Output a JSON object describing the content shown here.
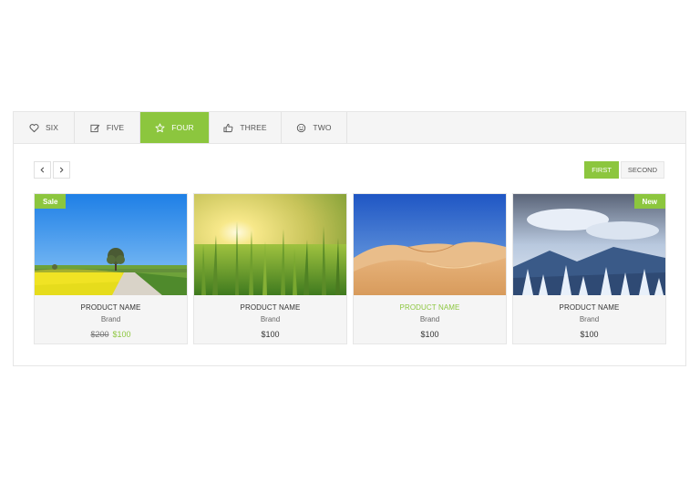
{
  "tabs": [
    {
      "label": "SIX",
      "icon": "heart-icon",
      "active": false
    },
    {
      "label": "FIVE",
      "icon": "edit-icon",
      "active": false
    },
    {
      "label": "FOUR",
      "icon": "star-icon",
      "active": true
    },
    {
      "label": "THREE",
      "icon": "thumbs-up-icon",
      "active": false
    },
    {
      "label": "TWO",
      "icon": "smile-icon",
      "active": false
    }
  ],
  "subtabs": [
    {
      "label": "FIRST",
      "active": true
    },
    {
      "label": "SECOND",
      "active": false
    }
  ],
  "products": [
    {
      "name": "PRODUCT NAME",
      "brand": "Brand",
      "old_price": "$200",
      "price": "$100",
      "badge": "Sale",
      "image": "road-field-photo",
      "highlight": false
    },
    {
      "name": "PRODUCT NAME",
      "brand": "Brand",
      "price": "$100",
      "image": "wheat-field-photo",
      "highlight": false
    },
    {
      "name": "PRODUCT NAME",
      "brand": "Brand",
      "price": "$100",
      "image": "desert-dunes-photo",
      "highlight": true
    },
    {
      "name": "PRODUCT NAME",
      "brand": "Brand",
      "price": "$100",
      "badge": "New",
      "image": "snowy-mountain-photo",
      "highlight": false
    }
  ],
  "colors": {
    "accent": "#8cc63e",
    "tab_bg": "#f5f5f5",
    "border": "#e6e6e6"
  }
}
